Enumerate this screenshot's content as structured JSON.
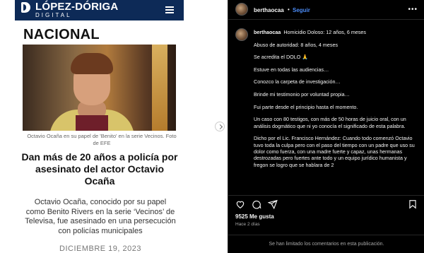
{
  "article": {
    "brand": "LÓPEZ-DÓRIGA",
    "brand_sub": "DIGITAL",
    "section": "NACIONAL",
    "caption": "Octavio Ocaña en su papel de 'Benito' en la serie Vecinos. Foto de EFE",
    "headline": "Dan más de 20 años a policía por asesinato del actor Octavio Ocaña",
    "summary": "Octavio Ocaña, conocido por su papel como Benito Rivers en la serie ‘Vecinos’ de Televisa, fue asesinado en una persecución con policías municipales",
    "date": "DICIEMBRE 19, 2023"
  },
  "post": {
    "username": "berthaocaa",
    "sep": "•",
    "follow_label": "Seguir",
    "more": "•••",
    "comment_lines": [
      "Homicidio Doloso: 12 años, 6 meses",
      "Abuso de autoridad: 8 años, 4 meses",
      "Se acredita el DOLO 🙏",
      "Estuve en todas las audiencias…",
      "Conozco la carpeta de investigación…",
      "Brinde mi testimonio por voluntad propia…",
      "Fui parte desde el principio hasta el momento.",
      "Un caso con 80 testigos, con más de 50 horas de juicio oral, con un análisis dogmático que ni yo conocía el significado de esta palabra.",
      "Dicho por el Lic. Francisco Hernández: Cuando todo comenzó Octavio tuvo toda la culpa pero con el paso del tiempo con un padre que uso su dolor como fuerza, con una madre fuerte y capaz, unas hermanas destrozadas pero fuertes ante todo y un equipo jurídico humanista y fregon se logro que se hablara de 2"
    ],
    "likes": "9525 Me gusta",
    "time_ago": "Hace 2 días",
    "comments_closed": "Se han limitado los comentarios en esta publicación."
  },
  "icons": {
    "heart": "heart-icon",
    "comment": "comment-icon",
    "share": "share-icon",
    "save": "bookmark-icon",
    "more": "more-options-icon",
    "menu": "hamburger-menu-icon",
    "next": "chevron-right-icon"
  },
  "colors": {
    "brand_navy": "#0d2a57",
    "follow_blue": "#4c8cf6",
    "background": "#000000"
  }
}
